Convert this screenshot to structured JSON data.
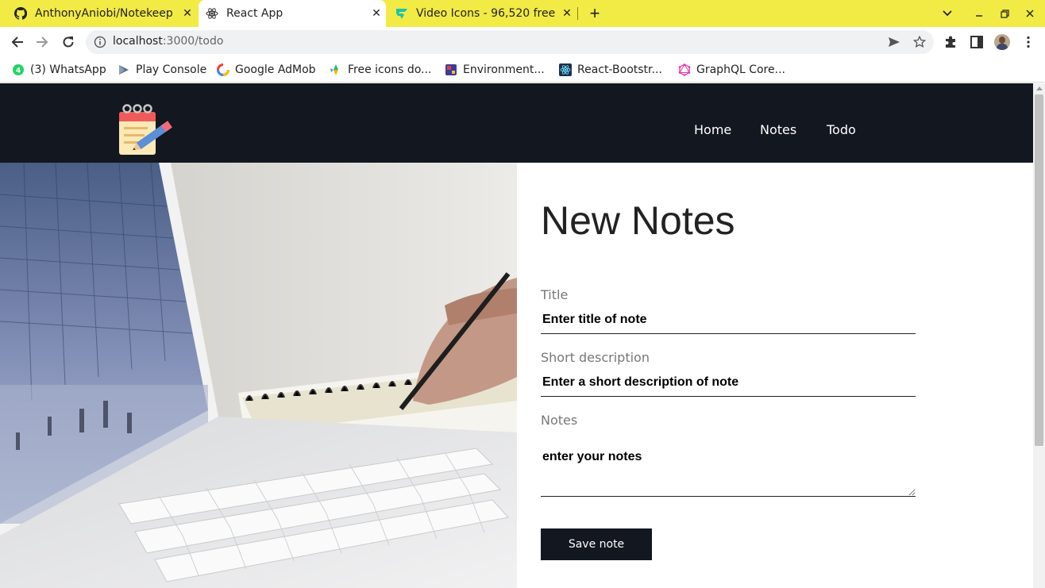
{
  "browser": {
    "tabs": [
      {
        "title": "AnthonyAniobi/Notekeep",
        "icon": "github-icon",
        "active": false
      },
      {
        "title": "React App",
        "icon": "react-icon",
        "active": true
      },
      {
        "title": "Video Icons - 96,520 free ic",
        "icon": "flaticon-icon",
        "active": false
      }
    ],
    "url_host": "localhost",
    "url_path": ":3000/todo",
    "bookmarks": [
      {
        "label": "(3) WhatsApp",
        "icon": "whatsapp-icon"
      },
      {
        "label": "Play Console",
        "icon": "play-console-icon"
      },
      {
        "label": "Google AdMob",
        "icon": "admob-icon"
      },
      {
        "label": "Free icons do...",
        "icon": "flaticon-icon"
      },
      {
        "label": "Environment...",
        "icon": "environment-icon"
      },
      {
        "label": "React-Bootstr...",
        "icon": "react-bootstrap-icon"
      },
      {
        "label": "GraphQL Core...",
        "icon": "graphql-icon"
      }
    ],
    "theme_color": "#f2ea45"
  },
  "app": {
    "logo_icon": "notepad-pencil-icon",
    "nav": [
      "Home",
      "Notes",
      "Todo"
    ],
    "nav_bg": "#131720",
    "hero_image": "laptop-notebook-photo",
    "form": {
      "heading": "New Notes",
      "title_label": "Title",
      "title_placeholder": "Enter title of note",
      "description_label": "Short description",
      "description_placeholder": "Enter a short description of note",
      "notes_label": "Notes",
      "notes_placeholder": "enter your notes",
      "save_label": "Save note"
    }
  }
}
